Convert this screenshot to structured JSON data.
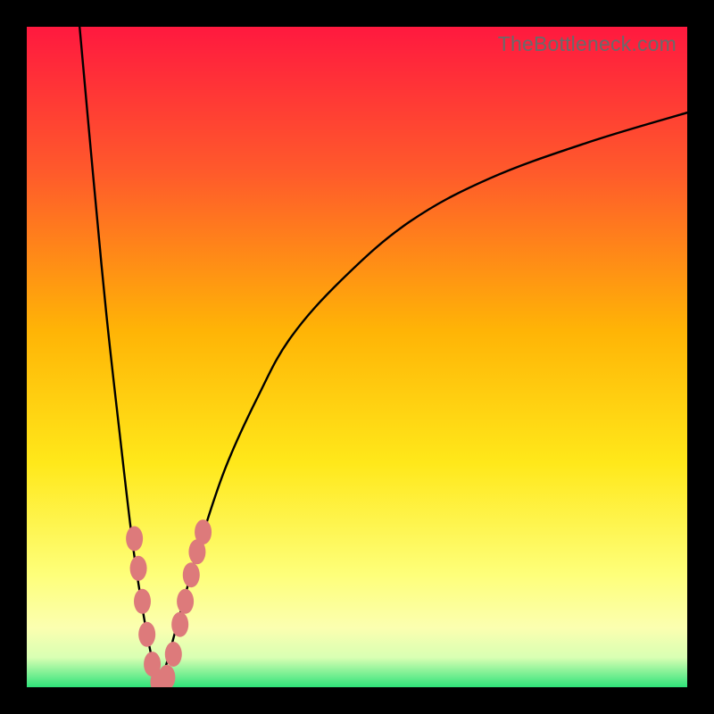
{
  "watermark": "TheBottleneck.com",
  "colors": {
    "frame": "#000000",
    "curve": "#000000",
    "marker_fill": "#dd7a7b",
    "marker_stroke": "#c96364",
    "grad_top": "#ff193f",
    "grad_mid1": "#ff5a2b",
    "grad_mid2": "#ffb406",
    "grad_mid3": "#ffe81a",
    "grad_mid4": "#feff7a",
    "grad_bottom": "#2fe37a"
  },
  "chart_data": {
    "type": "line",
    "title": "",
    "xlabel": "",
    "ylabel": "",
    "xlim": [
      0,
      100
    ],
    "ylim": [
      0,
      100
    ],
    "notes": "V-shaped bottleneck curve. Minimum near x≈20, y≈0. Left branch rises to y=100 near x≈8; right branch asymptotically approaches y≈87 at x=100. Background is a vertical rainbow gradient from red (top) through orange/yellow to green (bottom). Salmon-colored oval markers cluster near the trough on both branches.",
    "series": [
      {
        "name": "left-branch",
        "x": [
          8.0,
          10.0,
          12.0,
          14.0,
          16.0,
          17.5,
          18.5,
          19.5,
          20.0
        ],
        "y": [
          100.0,
          78.0,
          57.0,
          39.0,
          22.0,
          12.0,
          6.5,
          2.0,
          0.0
        ]
      },
      {
        "name": "right-branch",
        "x": [
          20.0,
          21.0,
          22.5,
          24.0,
          26.0,
          30.0,
          35.0,
          40.0,
          48.0,
          58.0,
          70.0,
          85.0,
          100.0
        ],
        "y": [
          0.0,
          3.0,
          8.5,
          14.0,
          21.0,
          33.0,
          44.0,
          53.0,
          62.0,
          70.5,
          77.0,
          82.5,
          87.0
        ]
      }
    ],
    "markers": [
      {
        "x": 16.3,
        "y": 22.5
      },
      {
        "x": 16.9,
        "y": 18.0
      },
      {
        "x": 17.5,
        "y": 13.0
      },
      {
        "x": 18.2,
        "y": 8.0
      },
      {
        "x": 19.0,
        "y": 3.5
      },
      {
        "x": 20.0,
        "y": 0.8
      },
      {
        "x": 21.2,
        "y": 1.5
      },
      {
        "x": 22.2,
        "y": 5.0
      },
      {
        "x": 23.2,
        "y": 9.5
      },
      {
        "x": 24.0,
        "y": 13.0
      },
      {
        "x": 24.9,
        "y": 17.0
      },
      {
        "x": 25.8,
        "y": 20.5
      },
      {
        "x": 26.7,
        "y": 23.5
      }
    ]
  }
}
